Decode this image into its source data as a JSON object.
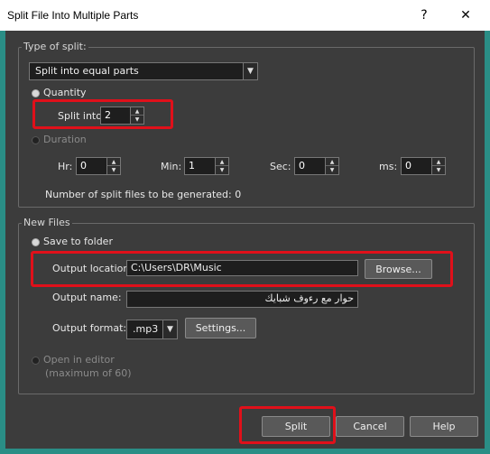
{
  "window": {
    "title": "Split File Into Multiple Parts",
    "help_glyph": "?",
    "close_glyph": "✕"
  },
  "type_of_split": {
    "group_label": "Type of split:",
    "mode_selected": "Split into equal parts",
    "quantity_label": "Quantity",
    "split_into_label": "Split into",
    "split_into_value": "2",
    "duration_label": "Duration",
    "hr_label": "Hr:",
    "hr_value": "0",
    "min_label": "Min:",
    "min_value": "1",
    "sec_label": "Sec:",
    "sec_value": "0",
    "ms_label": "ms:",
    "ms_value": "0",
    "count_text": "Number of split files to be generated: 0",
    "selected_option": "quantity"
  },
  "new_files": {
    "group_label": "New Files",
    "save_to_folder_label": "Save to folder",
    "output_location_label": "Output location:",
    "output_location_value": "C:\\Users\\DR\\Music",
    "browse_label": "Browse...",
    "output_name_label": "Output name:",
    "output_name_value": "حوار مع رءوف شبايك",
    "output_format_label": "Output format:",
    "output_format_value": ".mp3",
    "settings_label": "Settings...",
    "open_in_editor_label": "Open in editor",
    "open_in_editor_hint": "(maximum of 60)",
    "selected_option": "save_to_folder"
  },
  "footer": {
    "split_label": "Split",
    "cancel_label": "Cancel",
    "help_label": "Help"
  },
  "colors": {
    "highlight": "#e0101a",
    "dialog_bg": "#3c3c3c",
    "field_bg": "#1e1e1e",
    "border_teal": "#2a8e86"
  }
}
